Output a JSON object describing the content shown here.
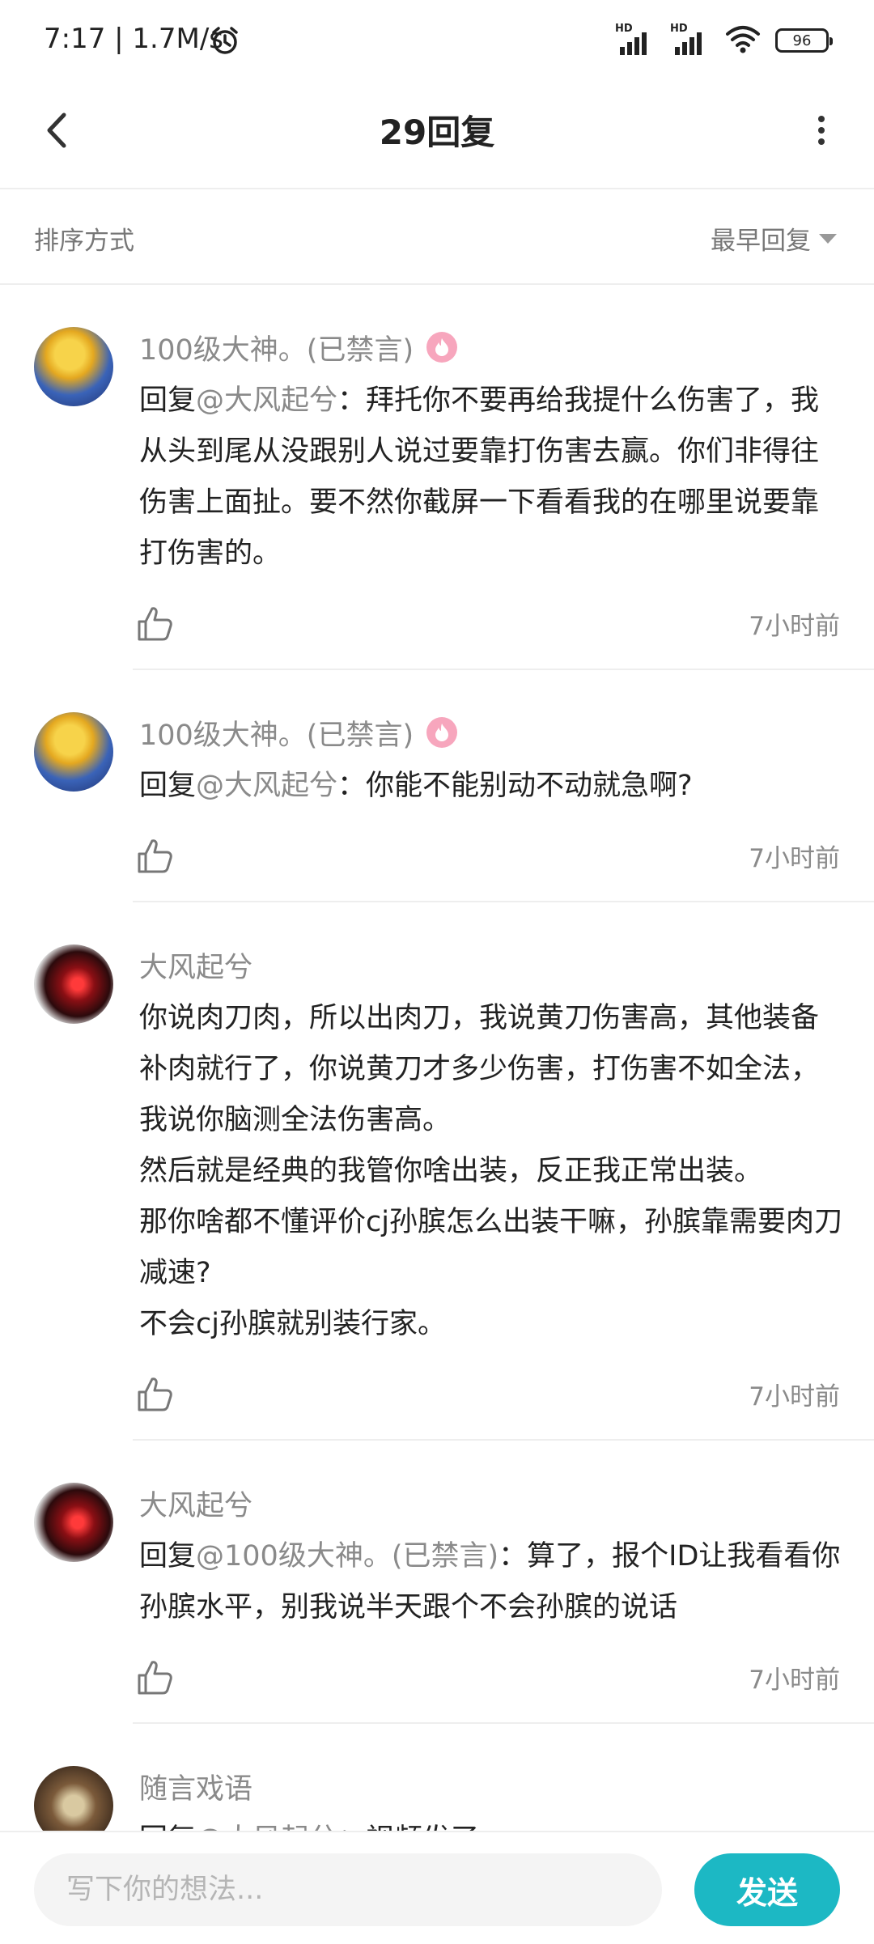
{
  "status": {
    "time": "7:17 | 1.7M/s",
    "battery": "96",
    "signal_label": "HD"
  },
  "header": {
    "title": "29回复"
  },
  "sort": {
    "label": "排序方式",
    "selected": "最早回复"
  },
  "comments": [
    {
      "author": "100级大神。(已禁言)",
      "badge": true,
      "reply_prefix": "回复",
      "mention": "@大风起兮",
      "separator": "：",
      "text": "拜托你不要再给我提什么伤害了，我从头到尾从没跟别人说过要靠打伤害去赢。你们非得往伤害上面扯。要不然你截屏一下看看我的在哪里说要靠打伤害的。",
      "time": "7小时前"
    },
    {
      "author": "100级大神。(已禁言)",
      "badge": true,
      "reply_prefix": "回复",
      "mention": "@大风起兮",
      "separator": "：",
      "text": "你能不能别动不动就急啊?",
      "time": "7小时前"
    },
    {
      "author": "大风起兮",
      "badge": false,
      "reply_prefix": "",
      "mention": "",
      "separator": "",
      "text": "你说肉刀肉，所以出肉刀，我说黄刀伤害高，其他装备补肉就行了，你说黄刀才多少伤害，打伤害不如全法，我说你脑测全法伤害高。\n然后就是经典的我管你啥出装，反正我正常出装。\n那你啥都不懂评价cj孙膑怎么出装干嘛，孙膑靠需要肉刀减速?\n不会cj孙膑就别装行家。",
      "time": "7小时前"
    },
    {
      "author": "大风起兮",
      "badge": false,
      "reply_prefix": "回复",
      "mention": "@100级大神。(已禁言)",
      "separator": "：",
      "text": "算了，报个ID让我看看你孙膑水平，别我说半天跟个不会孙膑的说话",
      "time": "7小时前"
    },
    {
      "author": "随言戏语",
      "badge": false,
      "reply_prefix": "回复",
      "mention": "@大风起兮",
      "separator": "：",
      "text": "视频发了",
      "time": ""
    }
  ],
  "composer": {
    "placeholder": "写下你的想法...",
    "send_label": "发送"
  },
  "colors": {
    "accent": "#1cb8c4",
    "muted": "#8a8a8a",
    "badge": "#f7a6bd"
  }
}
